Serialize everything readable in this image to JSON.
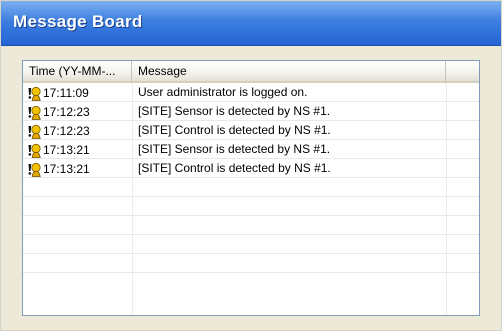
{
  "window": {
    "title": "Message Board"
  },
  "table": {
    "columns": [
      "Time (YY-MM-...",
      "Message",
      ""
    ],
    "rows": [
      {
        "time": "17:11:09",
        "message": "User administrator is logged on.",
        "icon": "info-user-icon"
      },
      {
        "time": "17:12:23",
        "message": "[SITE] Sensor is detected by NS #1.",
        "icon": "info-user-icon"
      },
      {
        "time": "17:12:23",
        "message": "[SITE] Control is detected by NS #1.",
        "icon": "info-user-icon"
      },
      {
        "time": "17:13:21",
        "message": "[SITE] Sensor is detected by NS #1.",
        "icon": "info-user-icon"
      },
      {
        "time": "17:13:21",
        "message": "[SITE] Control is detected by NS #1.",
        "icon": "info-user-icon"
      }
    ]
  },
  "colors": {
    "title_bar": "#2563d5",
    "window_bg": "#ece9d8"
  }
}
